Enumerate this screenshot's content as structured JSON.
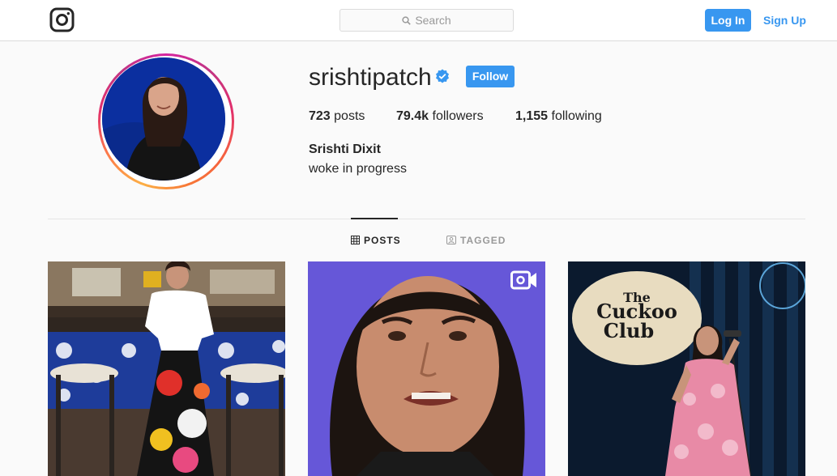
{
  "nav": {
    "search_placeholder": "Search",
    "login_label": "Log In",
    "signup_label": "Sign Up"
  },
  "profile": {
    "username": "srishtipatch",
    "verified": true,
    "follow_label": "Follow",
    "stats": {
      "posts_count": "723",
      "posts_label": "posts",
      "followers_count": "79.4k",
      "followers_label": "followers",
      "following_count": "1,155",
      "following_label": "following"
    },
    "full_name": "Srishti Dixit",
    "bio": "woke in progress"
  },
  "tabs": [
    {
      "label": "POSTS",
      "icon": "grid-icon",
      "active": true
    },
    {
      "label": "TAGGED",
      "icon": "tag-icon",
      "active": false
    }
  ],
  "posts": [
    {
      "type": "image"
    },
    {
      "type": "video",
      "icon": "video-icon"
    },
    {
      "type": "image",
      "sign_text": "The Cuckoo Club"
    }
  ],
  "colors": {
    "accent": "#3897f0",
    "text": "#262626",
    "muted": "#999999",
    "background": "#fafafa",
    "border": "#dbdbdb",
    "verified": "#3897f0"
  }
}
